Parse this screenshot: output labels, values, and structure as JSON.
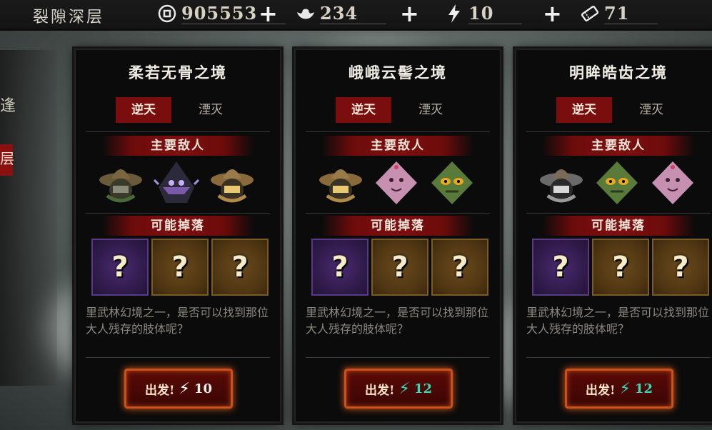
{
  "header": {
    "title": "裂隙深层",
    "resources": [
      {
        "icon": "coin-icon",
        "value": "905553"
      },
      {
        "icon": "silver-ingot-icon",
        "value": "234"
      },
      {
        "icon": "lightning-icon",
        "value": "10"
      },
      {
        "icon": "ticket-icon",
        "value": "71"
      }
    ]
  },
  "sidebar": {
    "item1": "逢",
    "item2": "层"
  },
  "cards": [
    {
      "title": "柔若无骨之境",
      "tab_active": "逆天",
      "tab_inactive": "湮灭",
      "enemies_label": "主要敌人",
      "enemies": [
        "straw-hat-bandit-icon",
        "shadow-ninja-icon",
        "straw-hat-bandit-icon"
      ],
      "drops_label": "可能掉落",
      "drops": [
        "?",
        "?",
        "?"
      ],
      "description": "里武林幻境之一，是否可以找到那位大人残存的肢体呢？",
      "go_label": "出发!",
      "cost": "10",
      "bolt_color": "#ffffff",
      "cost_color": "#f0f0f0"
    },
    {
      "title": "峨峨云髻之境",
      "tab_active": "逆天",
      "tab_inactive": "湮灭",
      "enemies_label": "主要敌人",
      "enemies": [
        "straw-hat-bandit-icon",
        "pink-blob-icon",
        "green-mask-icon"
      ],
      "drops_label": "可能掉落",
      "drops": [
        "?",
        "?",
        "?"
      ],
      "description": "里武林幻境之一，是否可以找到那位大人残存的肢体呢？",
      "go_label": "出发!",
      "cost": "12",
      "bolt_color": "#39d8b8",
      "cost_color": "#39d8b8"
    },
    {
      "title": "明眸皓齿之境",
      "tab_active": "逆天",
      "tab_inactive": "湮灭",
      "enemies_label": "主要敌人",
      "enemies": [
        "straw-hat-bandit-icon",
        "green-mask-icon",
        "pink-blob-icon"
      ],
      "drops_label": "可能掉落",
      "drops": [
        "?",
        "?",
        "?"
      ],
      "description": "里武林幻境之一，是否可以找到那位大人残存的肢体呢？",
      "go_label": "出发!",
      "cost": "12",
      "bolt_color": "#39d8b8",
      "cost_color": "#39d8b8"
    }
  ]
}
